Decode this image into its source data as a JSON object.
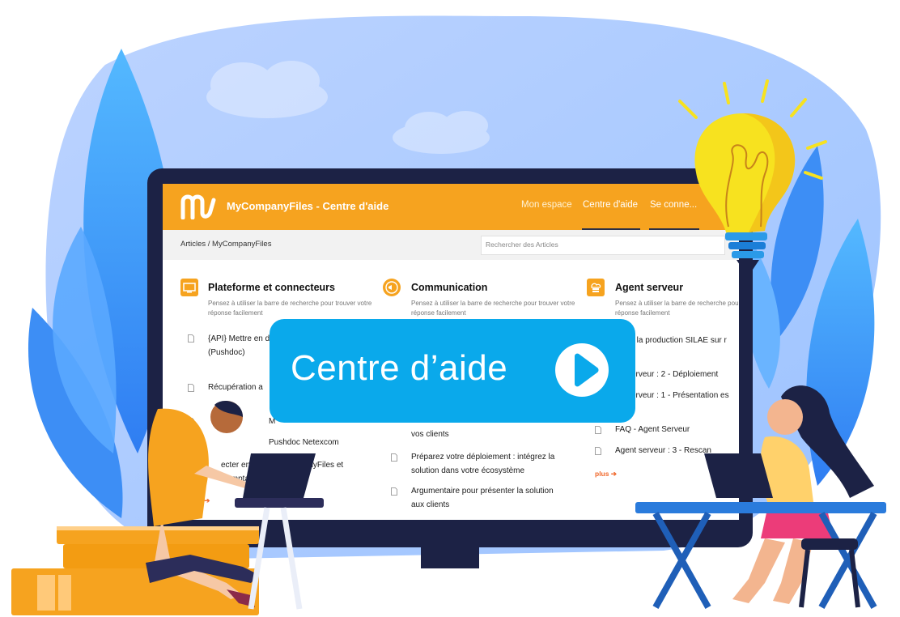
{
  "app": {
    "title": "MyCompanyFiles - Centre d'aide",
    "nav": [
      "Mon espace",
      "Centre d'aide",
      "Se conne..."
    ]
  },
  "breadcrumb": "Articles   /  MyCompanyFiles",
  "search": {
    "placeholder": "Rechercher des Articles"
  },
  "categories": [
    {
      "title": "Plateforme et connecteurs",
      "subtitle": "Pensez à utiliser la barre de recherche pour trouver votre réponse facilement",
      "icon": "screen-icon",
      "articles": [
        "{API} Mettre en documents de N (Pushdoc)",
        "Récupération a",
        "M",
        "Pushdoc Netexcom",
        "ecter en SSO MyCompanyFiles et Compta"
      ],
      "more": "us"
    },
    {
      "title": "Communication",
      "subtitle": "Pensez à utiliser la barre de recherche pour trouver votre réponse facilement",
      "icon": "megaphone-icon",
      "articles": [
        "vos clients",
        "Préparez votre déploiement : intégrez la solution dans votre écosystème",
        "Argumentaire pour présenter la solution aux clients"
      ]
    },
    {
      "title": "Agent serveur",
      "subtitle": "Pensez à utiliser la barre de recherche pour trouver votre réponse facilement",
      "icon": "cloud-server-icon",
      "articles": [
        "er la production SILAE sur r",
        "serveur : 2 - Déploiement",
        "serveur : 1 - Présentation es",
        "FAQ - Agent Serveur",
        "Agent serveur : 3 - Rescan"
      ],
      "more": "plus"
    }
  ],
  "banner": {
    "text": "Centre d’aide",
    "icon": "play-icon"
  },
  "colors": {
    "accent": "#f6a31f",
    "banner": "#0aa9eb",
    "monitor": "#1c2245",
    "more_link": "#f0682b"
  }
}
